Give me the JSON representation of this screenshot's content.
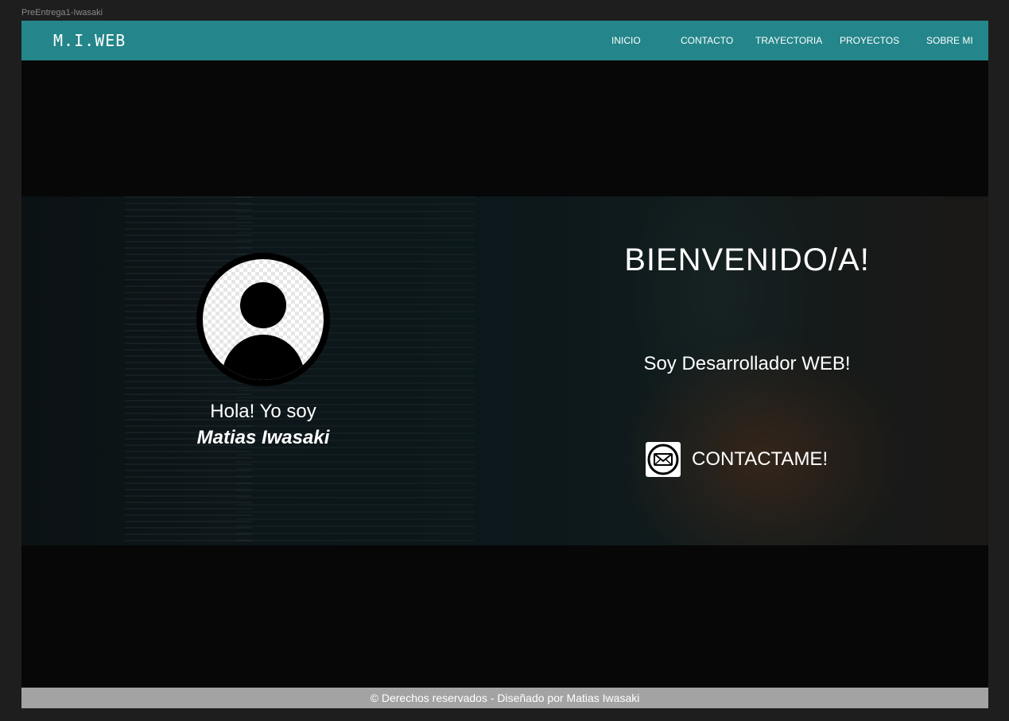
{
  "window": {
    "title": "PreEntrega1-Iwasaki"
  },
  "navbar": {
    "logo": "M.I.WEB",
    "items": [
      {
        "label": "INICIO"
      },
      {
        "label": "CONTACTO"
      },
      {
        "label": "TRAYECTORIA"
      },
      {
        "label": "PROYECTOS"
      },
      {
        "label": "SOBRE MI"
      }
    ],
    "color": "#24868a"
  },
  "hero": {
    "greeting": "Hola! Yo soy",
    "name": "Matias Iwasaki",
    "welcome": "BIENVENIDO/A!",
    "tagline": "Soy Desarrollador WEB!",
    "contact_button": "CONTACTAME!",
    "avatar_icon": "user-avatar-icon",
    "contact_icon": "envelope-icon"
  },
  "footer": {
    "text": "© Derechos reservados - Diseñado por Matias Iwasaki"
  }
}
